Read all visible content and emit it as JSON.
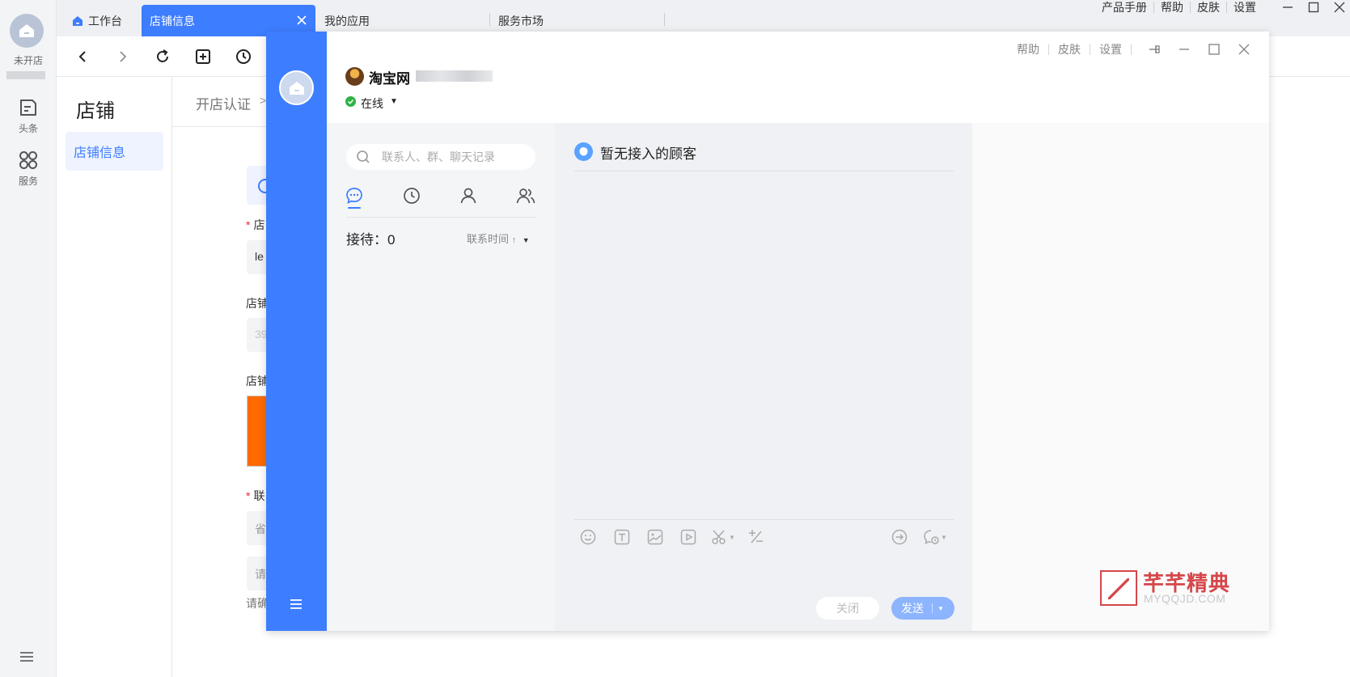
{
  "sidebar": {
    "status": "未开店",
    "nav": [
      {
        "label": "头条",
        "icon": "news-icon"
      },
      {
        "label": "服务",
        "icon": "apps-icon"
      }
    ]
  },
  "tabs": {
    "workbench": "工作台",
    "active": "店铺信息",
    "apps": "我的应用",
    "market": "服务市场"
  },
  "topmenu": {
    "manual": "产品手册",
    "help": "帮助",
    "skin": "皮肤",
    "settings": "设置"
  },
  "subnav": {
    "title": "店铺",
    "item": "店铺信息"
  },
  "content": {
    "breadcrumb": "开店认证",
    "crumb_sep": ">",
    "frag_name": "店",
    "frag_value": "le",
    "frag_shop1": "店铺",
    "frag_num": "39",
    "frag_shop2": "店铺",
    "frag_contact": "联",
    "frag_province": "省",
    "frag_input": "请",
    "frag_confirm": "请确"
  },
  "chat": {
    "shop_name": "淘宝网",
    "status": "在线",
    "window_menu": {
      "help": "帮助",
      "skin": "皮肤",
      "settings": "设置"
    },
    "search_placeholder": "联系人、群、聊天记录",
    "reception_label": "接待：",
    "reception_count": "0",
    "sort_label": "联系时间",
    "no_customer": "暂无接入的顾客",
    "close_button": "关闭",
    "send_button": "发送"
  },
  "watermark": {
    "title": "芊芊精典",
    "subtitle": "MYQQJD.COM"
  },
  "colors": {
    "brand": "#3d7dff",
    "online": "#2fb344",
    "watermark": "#d5474a"
  }
}
